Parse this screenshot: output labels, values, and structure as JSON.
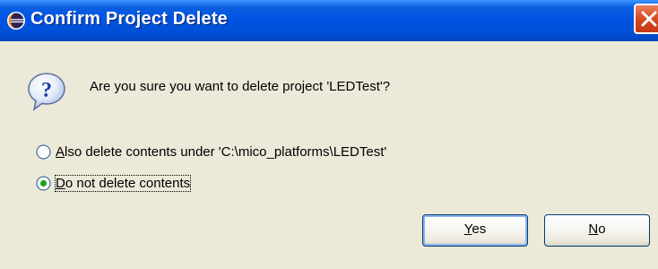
{
  "window": {
    "title": "Confirm Project Delete",
    "title_icon": "eclipse-icon",
    "close_icon": "close-icon"
  },
  "dialog": {
    "question_icon": "question-icon",
    "message": "Are you sure you want to delete project 'LEDTest'?",
    "options": [
      {
        "mnemonic": "A",
        "rest": "lso delete contents under 'C:\\mico_platforms\\LEDTest'",
        "selected": false
      },
      {
        "mnemonic": "D",
        "rest": "o not delete contents",
        "selected": true
      }
    ],
    "buttons": {
      "yes_mnemonic": "Y",
      "yes_rest": "es",
      "no_mnemonic": "N",
      "no_rest": "o"
    }
  },
  "colors": {
    "titlebar": "#0054e3",
    "client_background": "#ece9d8",
    "close_button": "#d84a22",
    "radio_dot": "#21a121",
    "button_border": "#003c74"
  }
}
